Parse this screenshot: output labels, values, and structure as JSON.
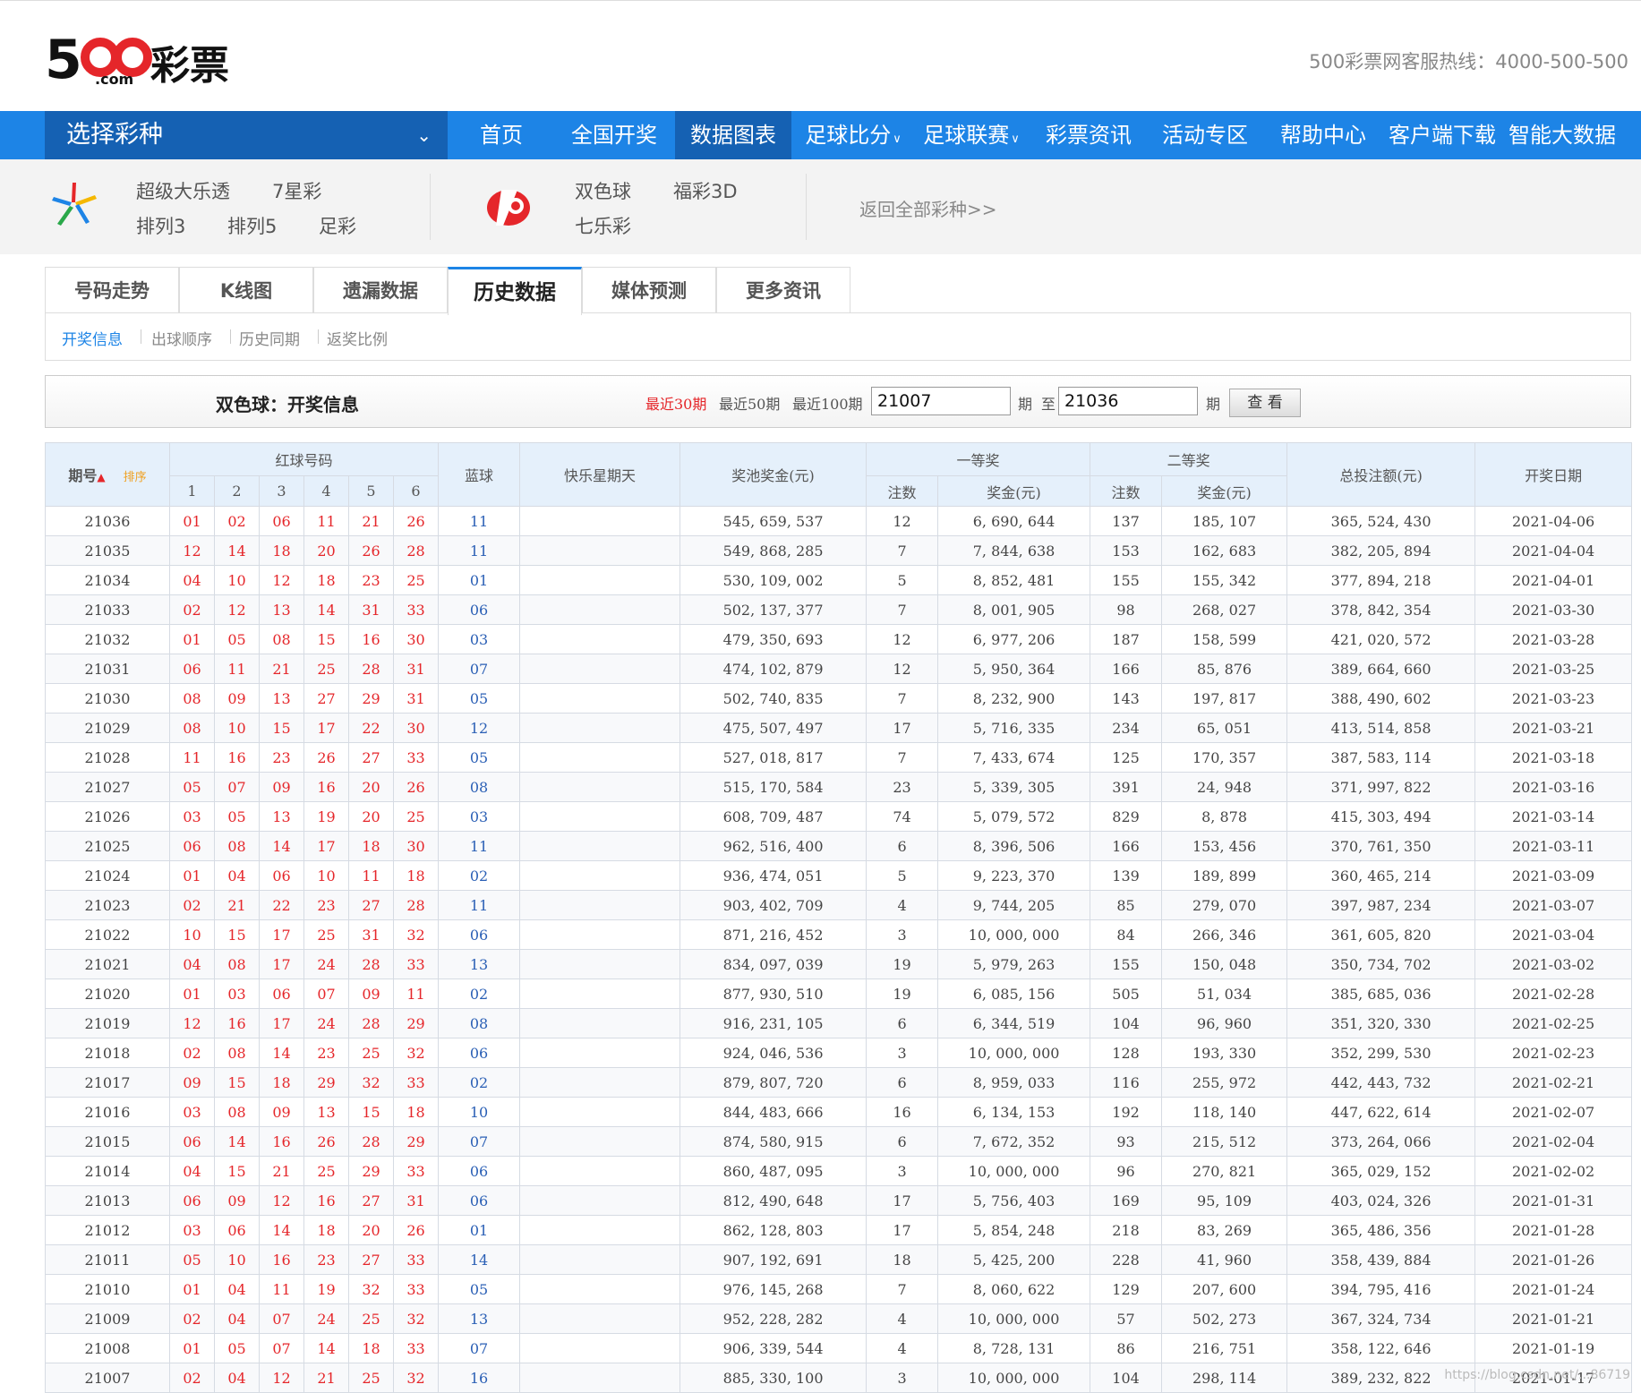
{
  "header": {
    "logo_text": "500 .com 彩票",
    "hotline": "500彩票网客服热线：4000-500-500"
  },
  "nav": {
    "select_label": "选择彩种",
    "items": [
      {
        "label": "首页",
        "dropdown": false
      },
      {
        "label": "全国开奖",
        "dropdown": false
      },
      {
        "label": "数据图表",
        "dropdown": false,
        "active": true
      },
      {
        "label": "足球比分",
        "dropdown": true
      },
      {
        "label": "足球联赛",
        "dropdown": true
      },
      {
        "label": "彩票资讯",
        "dropdown": false
      },
      {
        "label": "活动专区",
        "dropdown": false
      },
      {
        "label": "帮助中心",
        "dropdown": false
      },
      {
        "label": "客户端下载",
        "dropdown": false
      },
      {
        "label": "智能大数据",
        "dropdown": false
      }
    ]
  },
  "lotteries": {
    "sports": [
      "超级大乐透",
      "7星彩",
      "排列3",
      "排列5",
      "足彩"
    ],
    "welfare": [
      "双色球",
      "福彩3D",
      "七乐彩"
    ],
    "back_all": "返回全部彩种>>"
  },
  "tabs": [
    "号码走势",
    "K线图",
    "遗漏数据",
    "历史数据",
    "媒体预测",
    "更多资讯"
  ],
  "subtabs": [
    "开奖信息",
    "出球顺序",
    "历史同期",
    "返奖比例"
  ],
  "query": {
    "title": "双色球：开奖信息",
    "recent30": "最近30期",
    "recent50": "最近50期",
    "recent100": "最近100期",
    "from": "21007",
    "period_label": "期",
    "to_label": "至",
    "to": "21036",
    "button": "查 看"
  },
  "table_headers": {
    "issue": "期号",
    "sort": "排序",
    "red": "红球号码",
    "red_cols": [
      "1",
      "2",
      "3",
      "4",
      "5",
      "6"
    ],
    "blue": "蓝球",
    "happy_sunday": "快乐星期天",
    "pool": "奖池奖金(元)",
    "first": "一等奖",
    "second": "二等奖",
    "count": "注数",
    "prize": "奖金(元)",
    "total": "总投注额(元)",
    "date": "开奖日期"
  },
  "rows": [
    {
      "issue": "21036",
      "red": [
        "01",
        "02",
        "06",
        "11",
        "21",
        "26"
      ],
      "blue": "11",
      "pool": "545, 659, 537",
      "c1": "12",
      "p1": "6, 690, 644",
      "c2": "137",
      "p2": "185, 107",
      "total": "365, 524, 430",
      "date": "2021-04-06"
    },
    {
      "issue": "21035",
      "red": [
        "12",
        "14",
        "18",
        "20",
        "26",
        "28"
      ],
      "blue": "11",
      "pool": "549, 868, 285",
      "c1": "7",
      "p1": "7, 844, 638",
      "c2": "153",
      "p2": "162, 683",
      "total": "382, 205, 894",
      "date": "2021-04-04"
    },
    {
      "issue": "21034",
      "red": [
        "04",
        "10",
        "12",
        "18",
        "23",
        "25"
      ],
      "blue": "01",
      "pool": "530, 109, 002",
      "c1": "5",
      "p1": "8, 852, 481",
      "c2": "155",
      "p2": "155, 342",
      "total": "377, 894, 218",
      "date": "2021-04-01"
    },
    {
      "issue": "21033",
      "red": [
        "02",
        "12",
        "13",
        "14",
        "31",
        "33"
      ],
      "blue": "06",
      "pool": "502, 137, 377",
      "c1": "7",
      "p1": "8, 001, 905",
      "c2": "98",
      "p2": "268, 027",
      "total": "378, 842, 354",
      "date": "2021-03-30"
    },
    {
      "issue": "21032",
      "red": [
        "01",
        "05",
        "08",
        "15",
        "16",
        "30"
      ],
      "blue": "03",
      "pool": "479, 350, 693",
      "c1": "12",
      "p1": "6, 977, 206",
      "c2": "187",
      "p2": "158, 599",
      "total": "421, 020, 572",
      "date": "2021-03-28"
    },
    {
      "issue": "21031",
      "red": [
        "06",
        "11",
        "21",
        "25",
        "28",
        "31"
      ],
      "blue": "07",
      "pool": "474, 102, 879",
      "c1": "12",
      "p1": "5, 950, 364",
      "c2": "166",
      "p2": "85, 876",
      "total": "389, 664, 660",
      "date": "2021-03-25"
    },
    {
      "issue": "21030",
      "red": [
        "08",
        "09",
        "13",
        "27",
        "29",
        "31"
      ],
      "blue": "05",
      "pool": "502, 740, 835",
      "c1": "7",
      "p1": "8, 232, 900",
      "c2": "143",
      "p2": "197, 817",
      "total": "388, 490, 602",
      "date": "2021-03-23"
    },
    {
      "issue": "21029",
      "red": [
        "08",
        "10",
        "15",
        "17",
        "22",
        "30"
      ],
      "blue": "12",
      "pool": "475, 507, 497",
      "c1": "17",
      "p1": "5, 716, 335",
      "c2": "234",
      "p2": "65, 051",
      "total": "413, 514, 858",
      "date": "2021-03-21"
    },
    {
      "issue": "21028",
      "red": [
        "11",
        "16",
        "23",
        "26",
        "27",
        "33"
      ],
      "blue": "05",
      "pool": "527, 018, 817",
      "c1": "7",
      "p1": "7, 433, 674",
      "c2": "125",
      "p2": "170, 357",
      "total": "387, 583, 114",
      "date": "2021-03-18"
    },
    {
      "issue": "21027",
      "red": [
        "05",
        "07",
        "09",
        "16",
        "20",
        "26"
      ],
      "blue": "08",
      "pool": "515, 170, 584",
      "c1": "23",
      "p1": "5, 339, 305",
      "c2": "391",
      "p2": "24, 948",
      "total": "371, 997, 822",
      "date": "2021-03-16"
    },
    {
      "issue": "21026",
      "red": [
        "03",
        "05",
        "13",
        "19",
        "20",
        "25"
      ],
      "blue": "03",
      "pool": "608, 709, 487",
      "c1": "74",
      "p1": "5, 079, 572",
      "c2": "829",
      "p2": "8, 878",
      "total": "415, 303, 494",
      "date": "2021-03-14"
    },
    {
      "issue": "21025",
      "red": [
        "06",
        "08",
        "14",
        "17",
        "18",
        "30"
      ],
      "blue": "11",
      "pool": "962, 516, 400",
      "c1": "6",
      "p1": "8, 396, 506",
      "c2": "166",
      "p2": "153, 456",
      "total": "370, 761, 350",
      "date": "2021-03-11"
    },
    {
      "issue": "21024",
      "red": [
        "01",
        "04",
        "06",
        "10",
        "11",
        "18"
      ],
      "blue": "02",
      "pool": "936, 474, 051",
      "c1": "5",
      "p1": "9, 223, 370",
      "c2": "139",
      "p2": "189, 899",
      "total": "360, 465, 214",
      "date": "2021-03-09"
    },
    {
      "issue": "21023",
      "red": [
        "02",
        "21",
        "22",
        "23",
        "27",
        "28"
      ],
      "blue": "11",
      "pool": "903, 402, 709",
      "c1": "4",
      "p1": "9, 744, 205",
      "c2": "85",
      "p2": "279, 070",
      "total": "397, 987, 234",
      "date": "2021-03-07"
    },
    {
      "issue": "21022",
      "red": [
        "10",
        "15",
        "17",
        "25",
        "31",
        "32"
      ],
      "blue": "06",
      "pool": "871, 216, 452",
      "c1": "3",
      "p1": "10, 000, 000",
      "c2": "84",
      "p2": "266, 346",
      "total": "361, 605, 820",
      "date": "2021-03-04"
    },
    {
      "issue": "21021",
      "red": [
        "04",
        "08",
        "17",
        "24",
        "28",
        "33"
      ],
      "blue": "13",
      "pool": "834, 097, 039",
      "c1": "19",
      "p1": "5, 979, 263",
      "c2": "155",
      "p2": "150, 048",
      "total": "350, 734, 702",
      "date": "2021-03-02"
    },
    {
      "issue": "21020",
      "red": [
        "01",
        "03",
        "06",
        "07",
        "09",
        "11"
      ],
      "blue": "02",
      "pool": "877, 930, 510",
      "c1": "19",
      "p1": "6, 085, 156",
      "c2": "505",
      "p2": "51, 034",
      "total": "385, 685, 036",
      "date": "2021-02-28"
    },
    {
      "issue": "21019",
      "red": [
        "12",
        "16",
        "17",
        "24",
        "28",
        "29"
      ],
      "blue": "08",
      "pool": "916, 231, 105",
      "c1": "6",
      "p1": "6, 344, 519",
      "c2": "104",
      "p2": "96, 960",
      "total": "351, 320, 330",
      "date": "2021-02-25"
    },
    {
      "issue": "21018",
      "red": [
        "02",
        "08",
        "14",
        "23",
        "25",
        "32"
      ],
      "blue": "06",
      "pool": "924, 046, 536",
      "c1": "3",
      "p1": "10, 000, 000",
      "c2": "128",
      "p2": "193, 330",
      "total": "352, 299, 530",
      "date": "2021-02-23"
    },
    {
      "issue": "21017",
      "red": [
        "09",
        "15",
        "18",
        "29",
        "32",
        "33"
      ],
      "blue": "02",
      "pool": "879, 807, 720",
      "c1": "6",
      "p1": "8, 959, 033",
      "c2": "116",
      "p2": "255, 972",
      "total": "442, 443, 732",
      "date": "2021-02-21"
    },
    {
      "issue": "21016",
      "red": [
        "03",
        "08",
        "09",
        "13",
        "15",
        "18"
      ],
      "blue": "10",
      "pool": "844, 483, 666",
      "c1": "16",
      "p1": "6, 134, 153",
      "c2": "192",
      "p2": "118, 140",
      "total": "447, 622, 614",
      "date": "2021-02-07"
    },
    {
      "issue": "21015",
      "red": [
        "06",
        "14",
        "16",
        "26",
        "28",
        "29"
      ],
      "blue": "07",
      "pool": "874, 580, 915",
      "c1": "6",
      "p1": "7, 672, 352",
      "c2": "93",
      "p2": "215, 512",
      "total": "373, 264, 066",
      "date": "2021-02-04"
    },
    {
      "issue": "21014",
      "red": [
        "04",
        "15",
        "21",
        "25",
        "29",
        "33"
      ],
      "blue": "06",
      "pool": "860, 487, 095",
      "c1": "3",
      "p1": "10, 000, 000",
      "c2": "96",
      "p2": "270, 821",
      "total": "365, 029, 152",
      "date": "2021-02-02"
    },
    {
      "issue": "21013",
      "red": [
        "06",
        "09",
        "12",
        "16",
        "27",
        "31"
      ],
      "blue": "06",
      "pool": "812, 490, 648",
      "c1": "17",
      "p1": "5, 756, 403",
      "c2": "169",
      "p2": "95, 109",
      "total": "403, 024, 326",
      "date": "2021-01-31"
    },
    {
      "issue": "21012",
      "red": [
        "03",
        "06",
        "14",
        "18",
        "20",
        "26"
      ],
      "blue": "01",
      "pool": "862, 128, 803",
      "c1": "17",
      "p1": "5, 854, 248",
      "c2": "218",
      "p2": "83, 269",
      "total": "365, 486, 356",
      "date": "2021-01-28"
    },
    {
      "issue": "21011",
      "red": [
        "05",
        "10",
        "16",
        "23",
        "27",
        "33"
      ],
      "blue": "14",
      "pool": "907, 192, 691",
      "c1": "18",
      "p1": "5, 425, 200",
      "c2": "228",
      "p2": "41, 960",
      "total": "358, 439, 884",
      "date": "2021-01-26"
    },
    {
      "issue": "21010",
      "red": [
        "01",
        "04",
        "11",
        "19",
        "32",
        "33"
      ],
      "blue": "05",
      "pool": "976, 145, 268",
      "c1": "7",
      "p1": "8, 060, 622",
      "c2": "129",
      "p2": "207, 600",
      "total": "394, 795, 416",
      "date": "2021-01-24"
    },
    {
      "issue": "21009",
      "red": [
        "02",
        "04",
        "07",
        "24",
        "25",
        "32"
      ],
      "blue": "13",
      "pool": "952, 228, 282",
      "c1": "4",
      "p1": "10, 000, 000",
      "c2": "57",
      "p2": "502, 273",
      "total": "367, 324, 734",
      "date": "2021-01-21"
    },
    {
      "issue": "21008",
      "red": [
        "01",
        "05",
        "07",
        "14",
        "18",
        "33"
      ],
      "blue": "07",
      "pool": "906, 339, 544",
      "c1": "4",
      "p1": "8, 728, 131",
      "c2": "86",
      "p2": "216, 751",
      "total": "358, 122, 646",
      "date": "2021-01-19"
    },
    {
      "issue": "21007",
      "red": [
        "02",
        "04",
        "12",
        "21",
        "25",
        "32"
      ],
      "blue": "16",
      "pool": "885, 330, 100",
      "c1": "3",
      "p1": "10, 000, 000",
      "c2": "104",
      "p2": "298, 114",
      "total": "389, 232, 822",
      "date": "2021-01-17"
    }
  ],
  "watermark": "https://blog.csdn.net/...86719",
  "colors": {
    "brand_blue": "#1d84e6",
    "nav_dark": "#1561b3",
    "red": "#e5262a",
    "ball_blue": "#2a5fb5"
  }
}
